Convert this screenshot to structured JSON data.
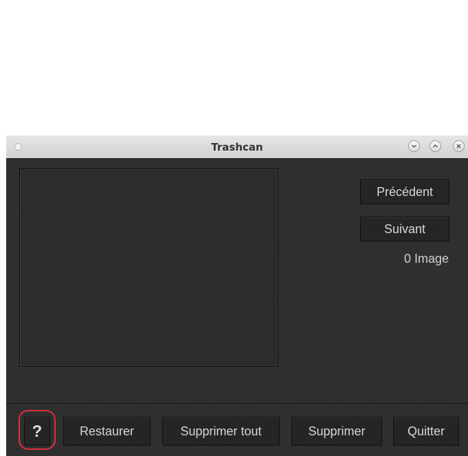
{
  "window": {
    "title": "Trashcan",
    "controls": {
      "minimize_icon": "chevron-down-icon",
      "maximize_icon": "chevron-up-icon",
      "close_icon": "close-icon"
    }
  },
  "nav": {
    "previous_label": "Précédent",
    "next_label": "Suivant",
    "image_count": "0 Image"
  },
  "footer": {
    "help_label": "?",
    "restore_label": "Restaurer",
    "delete_all_label": "Supprimer tout",
    "delete_label": "Supprimer",
    "quit_label": "Quitter"
  },
  "colors": {
    "window_background": "#2f2f2f",
    "titlebar": "#dcdcdc",
    "button_background": "#252525",
    "button_text": "#d6d6d6",
    "highlight_ring": "#e03040"
  }
}
